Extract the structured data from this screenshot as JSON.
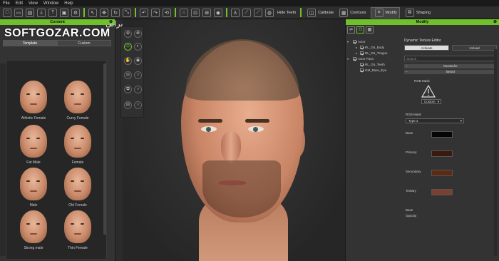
{
  "menu": [
    "File",
    "Edit",
    "View",
    "Window",
    "Help"
  ],
  "toolbar": {
    "hide_teeth": "Hide Teeth",
    "calibrate": "Calibrate",
    "contours": "Contours",
    "modify": "Modify",
    "shaping": "Shaping"
  },
  "content_panel": {
    "title": "Content",
    "watermark": "SOFTGOZAR.COM",
    "watermark_fa": "دانلود نرم افزار ایرانی",
    "tabs": [
      "Template",
      "Custom"
    ],
    "items": [
      "Athletic Female",
      "Curvy Female",
      "Fat Male",
      "Female",
      "Male",
      "Old Female",
      "Strong male",
      "Thin Female"
    ],
    "add_button": "+"
  },
  "modify_panel": {
    "title": "Modify",
    "tree": [
      {
        "label": "Actor",
        "checked": true,
        "indent": 0
      },
      {
        "label": "RL_G6_Body",
        "checked": true,
        "indent": 1
      },
      {
        "label": "RL_G6_Tongue",
        "checked": true,
        "indent": 1
      },
      {
        "label": "Actor Parts",
        "checked": true,
        "indent": 0
      },
      {
        "label": "RL_G6_Teeth",
        "checked": true,
        "indent": 1
      },
      {
        "label": "GM_Base_Eye",
        "checked": true,
        "indent": 1
      }
    ],
    "dte": {
      "title": "Dynamic Texture Editor",
      "activate": "Activate",
      "unload": "Unload",
      "search_placeholder": "Search",
      "sections": [
        "Mustache",
        "Beard"
      ],
      "rgb_mask_label": "RGB Mask",
      "custom": "Custom",
      "rgb_mask_label2": "RGB Mask",
      "type": "Type 2",
      "base_label": "Base",
      "primary_label": "Primary",
      "secondary_label": "Secondary",
      "tertiary_label": "Tertiary",
      "base2_label": "Base",
      "opacity_label": "Opacity"
    },
    "colors": {
      "base": "#050505",
      "primary": "#3a1a0c",
      "secondary": "#5a2a14",
      "tertiary": "#7a4030"
    }
  }
}
